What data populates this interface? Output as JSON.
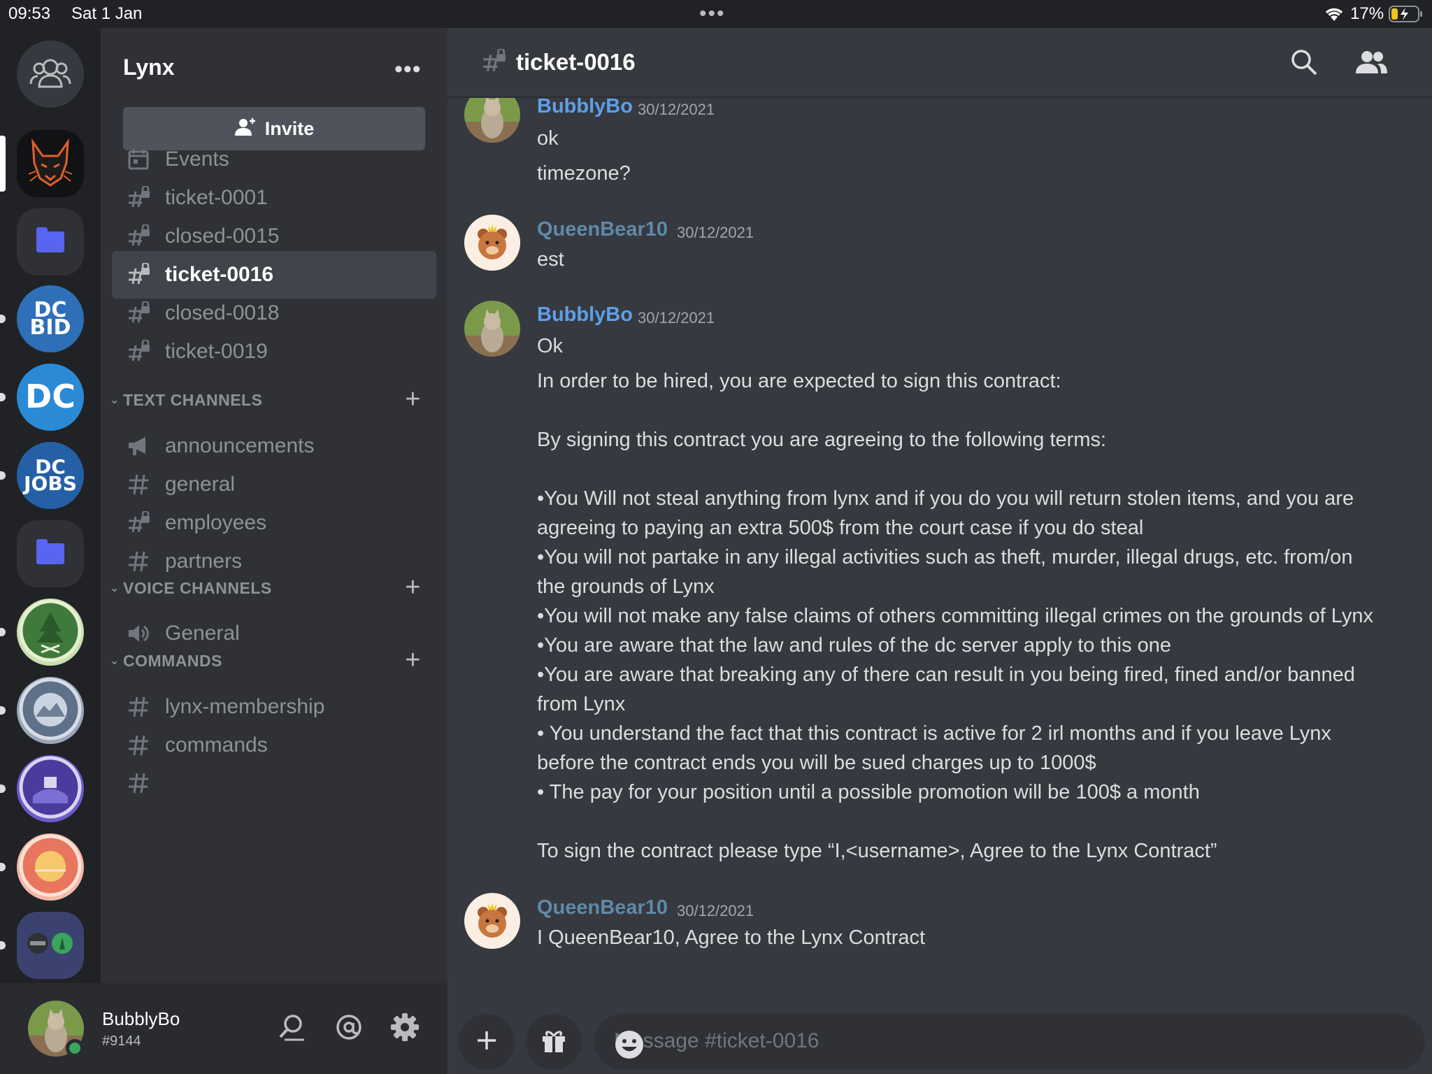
{
  "status_bar": {
    "time": "09:53",
    "date": "Sat 1 Jan",
    "battery": "17%"
  },
  "server": {
    "name": "Lynx",
    "invite_label": "Invite"
  },
  "channels": {
    "top": [
      {
        "label": "Events",
        "icon": "calendar-icon"
      },
      {
        "label": "ticket-0001",
        "icon": "locked-hash-icon"
      },
      {
        "label": "closed-0015",
        "icon": "locked-hash-icon"
      },
      {
        "label": "ticket-0016",
        "icon": "locked-hash-icon",
        "active": true
      },
      {
        "label": "closed-0018",
        "icon": "locked-hash-icon"
      },
      {
        "label": "ticket-0019",
        "icon": "locked-hash-icon"
      }
    ],
    "categories": [
      {
        "label": "TEXT CHANNELS",
        "items": [
          {
            "label": "announcements",
            "icon": "megaphone-icon"
          },
          {
            "label": "general",
            "icon": "hash-icon"
          },
          {
            "label": "employees",
            "icon": "locked-hash-icon"
          },
          {
            "label": "partners",
            "icon": "hash-icon"
          }
        ]
      },
      {
        "label": "VOICE CHANNELS",
        "items": [
          {
            "label": "General",
            "icon": "speaker-icon"
          }
        ]
      },
      {
        "label": "COMMANDS",
        "items": [
          {
            "label": "lynx-membership",
            "icon": "hash-icon"
          },
          {
            "label": "commands",
            "icon": "hash-icon"
          }
        ]
      }
    ]
  },
  "user": {
    "name": "BubblyBo",
    "tag": "#9144"
  },
  "chat": {
    "channel_title": "ticket-0016",
    "composer_placeholder": "Message #ticket-0016",
    "messages": [
      {
        "author": "BubblyBo",
        "time": "30/12/2021",
        "color": "#5ea0e8",
        "lines": [
          "ok",
          "timezone?"
        ]
      },
      {
        "author": "QueenBear10",
        "time": "30/12/2021",
        "color": "#5f8aa8",
        "lines": [
          "est"
        ]
      },
      {
        "author": "BubblyBo",
        "time": "30/12/2021",
        "color": "#5ea0e8",
        "lines": [
          "Ok",
          "In order to be hired, you are expected to sign this contract:",
          "By signing this contract you are agreeing to the following terms:",
          "•You Will not steal anything from lynx and if you do you will return stolen items, and you are",
          "agreeing to paying an extra 500$ from the court case if you do steal",
          "•You will not partake in any illegal activities such as theft, murder, illegal drugs, etc. from/on",
          "the grounds of Lynx",
          "•You will not make any false claims of others committing illegal crimes on the grounds of Lynx",
          "•You are aware that the law and rules of the dc server apply to this one",
          "•You are aware that breaking any of there can result in you being fired, fined and/or banned",
          "from Lynx",
          "• You understand the fact that this contract is active for 2 irl months and if you leave Lynx",
          "before the contract ends you will be sued charges up to 1000$",
          "• The pay for your position until a possible promotion will be 100$ a month",
          "To sign the contract please type “I,<username>, Agree to the Lynx Contract”"
        ]
      },
      {
        "author": "QueenBear10",
        "time": "30/12/2021",
        "color": "#5f8aa8",
        "lines": [
          "I QueenBear10, Agree to the Lynx Contract"
        ]
      }
    ]
  },
  "servers": {
    "server_2_text": "DC BID",
    "server_3_text": "DC",
    "server_4_text": "DC JOBS"
  },
  "colors": {
    "accent": "#5865f2",
    "online": "#3ba55d",
    "background": "#36393f",
    "sidebar": "#2f3136"
  }
}
